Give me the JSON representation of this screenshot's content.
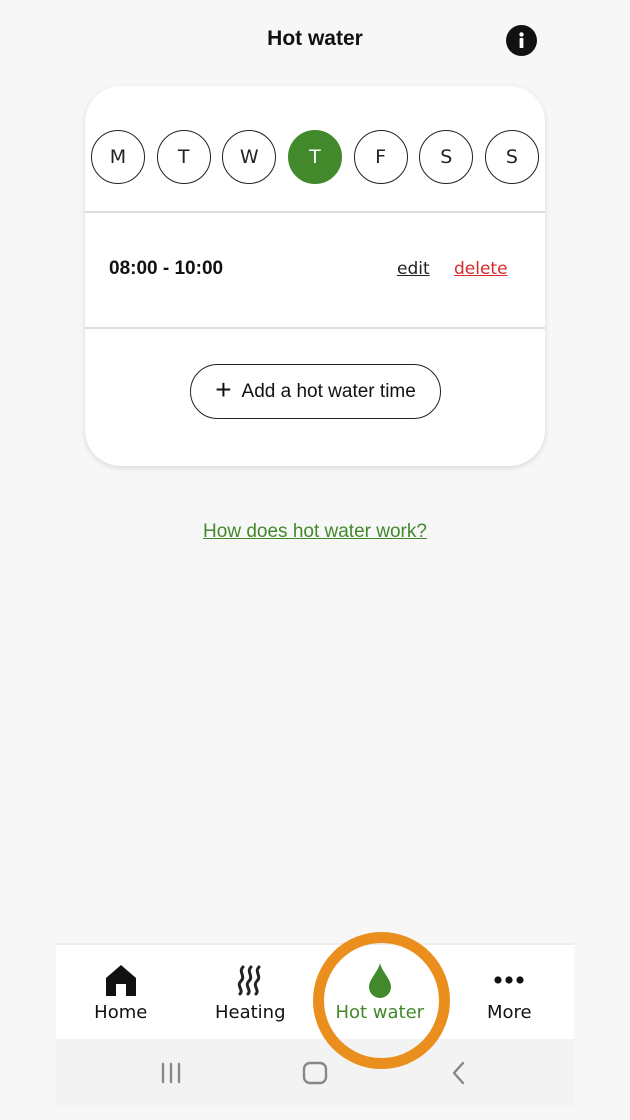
{
  "header": {
    "title": "Hot water",
    "info_icon": "info-icon"
  },
  "schedule": {
    "days": [
      {
        "label": "M",
        "selected": false
      },
      {
        "label": "T",
        "selected": false
      },
      {
        "label": "W",
        "selected": false
      },
      {
        "label": "T",
        "selected": true
      },
      {
        "label": "F",
        "selected": false
      },
      {
        "label": "S",
        "selected": false
      },
      {
        "label": "S",
        "selected": false
      }
    ],
    "slots": [
      {
        "time": "08:00 - 10:00",
        "edit_label": "edit",
        "delete_label": "delete"
      }
    ],
    "add_button": {
      "icon": "plus-icon",
      "label": "Add a hot water time"
    }
  },
  "help_link": "How does hot water work?",
  "nav": {
    "items": [
      {
        "label": "Home",
        "icon": "home-icon",
        "active": false
      },
      {
        "label": "Heating",
        "icon": "heat-waves-icon",
        "active": false
      },
      {
        "label": "Hot water",
        "icon": "water-drop-icon",
        "active": true
      },
      {
        "label": "More",
        "icon": "more-dots-icon",
        "active": false
      }
    ]
  },
  "system_bar": {
    "buttons": [
      "recent-apps-icon",
      "home-circle-icon",
      "back-icon"
    ]
  },
  "colors": {
    "accent_green": "#42892c",
    "delete_red": "#d42a2a",
    "highlight_orange": "#ea8f1e",
    "background": "#f7f7f7"
  }
}
